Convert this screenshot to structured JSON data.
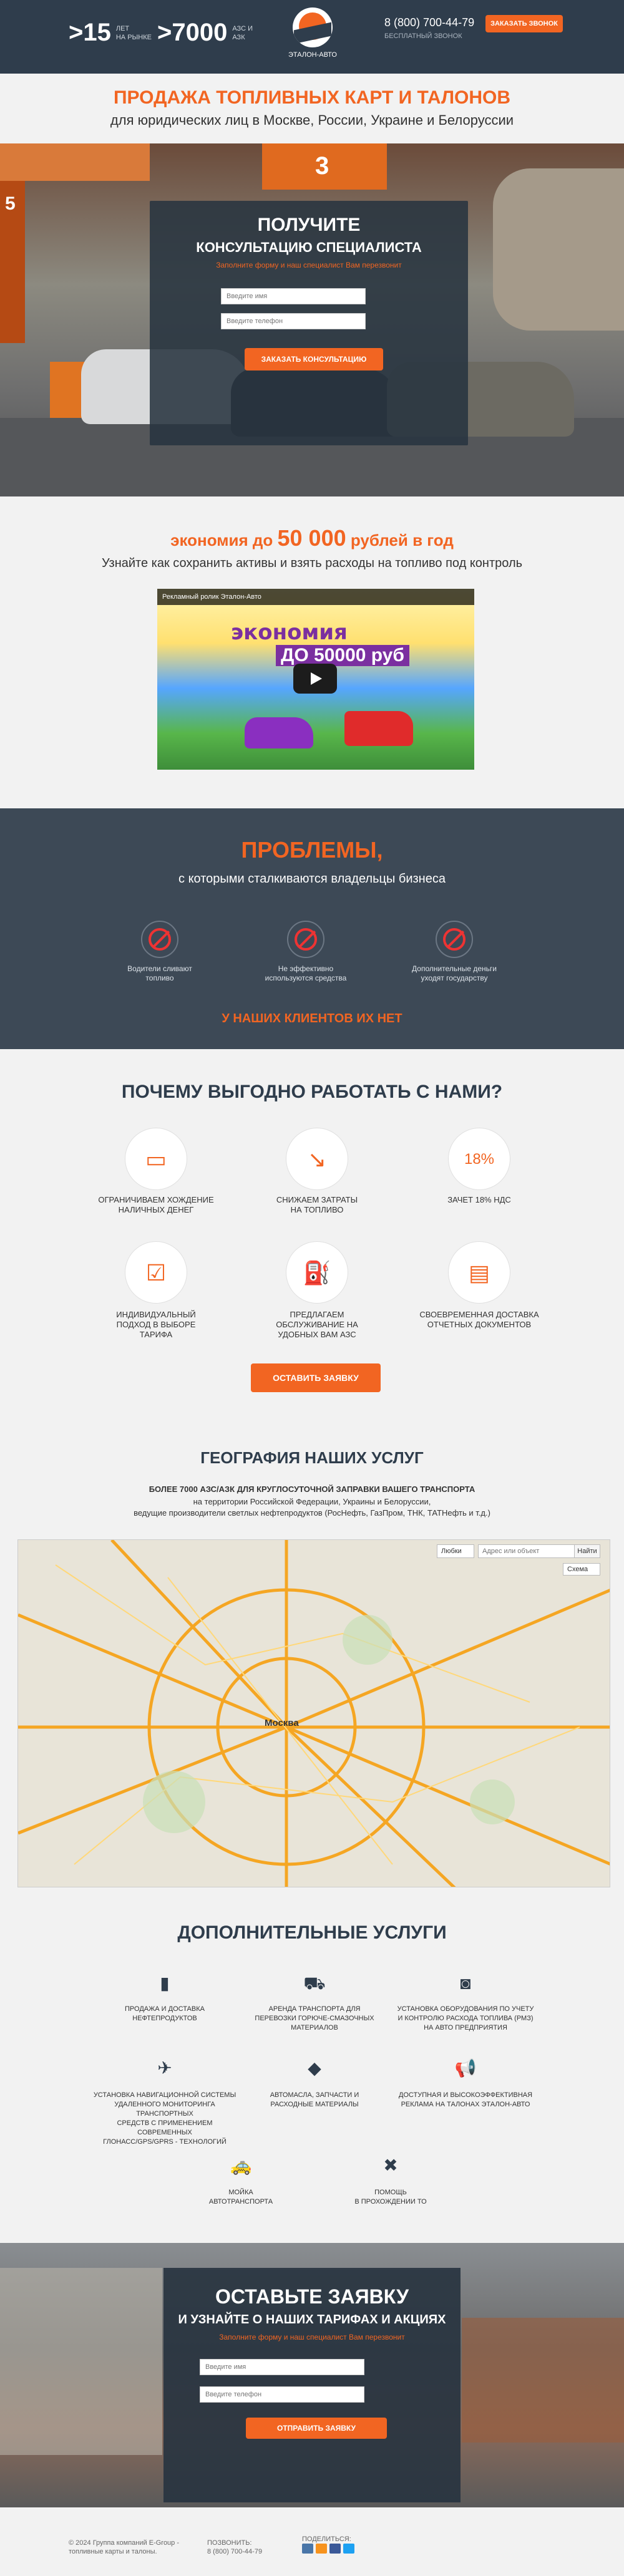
{
  "header": {
    "stat1_value": ">15",
    "stat1_label": "ЛЕТ\nНА РЫНКЕ",
    "stat2_value": ">7000",
    "stat2_label": "АЗС И\nАЗК",
    "logo_text": "ЭТАЛОН-АВТО",
    "phone": "8 (800) 700-44-79",
    "phone_sub": "БЕСПЛАТНЫЙ ЗВОНОК",
    "call_button": "ЗАКАЗАТЬ ЗВОНОК"
  },
  "hero": {
    "title": "ПРОДАЖА ТОПЛИВНЫХ КАРТ И ТАЛОНОВ",
    "subtitle": "для юридических лиц в Москве, России, Украине и Белоруссии",
    "pump_number_1": "3",
    "pump_number_2": "5",
    "form_title_1": "ПОЛУЧИТЕ",
    "form_title_2": "КОНСУЛЬТАЦИЮ СПЕЦИАЛИСТА",
    "form_hint": "Заполните форму и наш специалист Вам перезвонит",
    "name_placeholder": "Введите имя",
    "phone_placeholder": "Введите телефон",
    "submit": "ЗАКАЗАТЬ КОНСУЛЬТАЦИЮ"
  },
  "economy": {
    "prefix": "экономия до ",
    "number": "50 000",
    "suffix": " рублей в год",
    "subtitle": "Узнайте как сохранить активы и взять расходы на топливо под контроль",
    "video_title": "Рекламный ролик Эталон-Авто",
    "video_text_1": "экономия",
    "video_text_2": "ДО 50000 руб"
  },
  "problems": {
    "title": "ПРОБЛЕМЫ,",
    "subtitle": "с которыми сталкиваются владельцы бизнеса",
    "items": [
      {
        "label": "Водители сливают\nтопливо"
      },
      {
        "label": "Не эффективно\nиспользуются средства"
      },
      {
        "label": "Дополнительные деньги\nуходят государству"
      }
    ],
    "none_text": "У НАШИХ КЛИЕНТОВ ИХ НЕТ"
  },
  "why": {
    "title": "ПОЧЕМУ ВЫГОДНО РАБОТАТЬ С НАМИ?",
    "items": [
      {
        "icon": "card-icon",
        "glyph": "▭",
        "label": "ОГРАНИЧИВАЕМ ХОЖДЕНИЕ\nНАЛИЧНЫХ ДЕНЕГ"
      },
      {
        "icon": "chart-down-icon",
        "glyph": "↘",
        "label": "СНИЖАЕМ ЗАТРАТЫ\nНА ТОПЛИВО"
      },
      {
        "icon": "percent-icon",
        "glyph": "18%",
        "label": "ЗАЧЕТ 18% НДС"
      },
      {
        "icon": "checkbox-icon",
        "glyph": "☑",
        "label": "ИНДИВИДУАЛЬНЫЙ\nПОДХОД В ВЫБОРЕ\nТАРИФА"
      },
      {
        "icon": "fuel-nozzle-icon",
        "glyph": "⛽",
        "label": "ПРЕДЛАГАЕМ\nОБСЛУЖИВАНИЕ НА\nУДОБНЫХ ВАМ АЗС"
      },
      {
        "icon": "document-icon",
        "glyph": "▤",
        "label": "СВОЕВРЕМЕННАЯ ДОСТАВКА\nОТЧЕТНЫХ ДОКУМЕНТОВ"
      }
    ],
    "button": "ОСТАВИТЬ ЗАЯВКУ"
  },
  "geography": {
    "title": "ГЕОГРАФИЯ НАШИХ УСЛУГ",
    "line1": "БОЛЕЕ 7000 АЗС/АЗК ДЛЯ КРУГЛОСУТОЧНОЙ ЗАПРАВКИ ВАШЕГО ТРАНСПОРТА",
    "line2": "на территории Российской Федерации, Украины и Белоруссии,",
    "line3": "ведущие производители светлых нефтепродуктов (РосНефть, ГазПром, ТНК, ТАТНефть и т.д.)",
    "city": "Москва",
    "map_search_placeholder": "Адрес или объект",
    "map_find": "Найти",
    "map_type": "Схема",
    "map_favorites": "Любки"
  },
  "additional": {
    "title": "ДОПОЛНИТЕЛЬНЫЕ УСЛУГИ",
    "items": [
      {
        "icon": "fuel-can-icon",
        "glyph": "▮",
        "label": "ПРОДАЖА И ДОСТАВКА\nНЕФТЕПРОДУКТОВ"
      },
      {
        "icon": "truck-icon",
        "glyph": "⛟",
        "label": "АРЕНДА ТРАНСПОРТА ДЛЯ\nПЕРЕВОЗКИ ГОРЮЧЕ-СМАЗОЧНЫХ\nМАТЕРИАЛОВ"
      },
      {
        "icon": "device-icon",
        "glyph": "◙",
        "label": "УСТАНОВКА ОБОРУДОВАНИЯ ПО УЧЕТУ\nИ КОНТРОЛЮ РАСХОДА ТОПЛИВА (РМЗ)\nНА АВТО ПРЕДПРИЯТИЯ"
      },
      {
        "icon": "satellite-icon",
        "glyph": "✈",
        "label": "УСТАНОВКА НАВИГАЦИОННОЙ СИСТЕМЫ\nУДАЛЕННОГО МОНИТОРИНГА ТРАНСПОРТНЫХ\nСРЕДСТВ С ПРИМЕНЕНИЕМ СОВРЕМЕННЫХ\nГЛОНАСС/GPS/GPRS - ТЕХНОЛОГИЙ"
      },
      {
        "icon": "oil-can-icon",
        "glyph": "◆",
        "label": "АВТОМАСЛА, ЗАПЧАСТИ И\nРАСХОДНЫЕ МАТЕРИАЛЫ"
      },
      {
        "icon": "megaphone-icon",
        "glyph": "📢",
        "label": "ДОСТУПНАЯ И ВЫСОКОЭФФЕКТИВНАЯ\nРЕКЛАМА НА ТАЛОНАХ ЭТАЛОН-АВТО"
      },
      {
        "icon": "car-wash-icon",
        "glyph": "🚕",
        "label": "МОЙКА\nАВТОТРАНСПОРТА"
      },
      {
        "icon": "tools-icon",
        "glyph": "✖",
        "label": "ПОМОЩЬ\nВ ПРОХОЖДЕНИИ ТО"
      }
    ]
  },
  "bottom_form": {
    "title_1": "ОСТАВЬТЕ ЗАЯВКУ",
    "title_2": "И УЗНАЙТЕ О НАШИХ ТАРИФАХ И АКЦИЯХ",
    "hint": "Заполните форму и наш специалист Вам перезвонит",
    "name_placeholder": "Введите имя",
    "phone_placeholder": "Введите телефон",
    "submit": "ОТПРАВИТЬ ЗАЯВКУ"
  },
  "footer": {
    "copyright": "© 2024 Группа компаний Е-Group -\nтопливные карты и талоны.",
    "call_label": "ПОЗВОНИТЬ:",
    "phone": "8 (800) 700-44-79",
    "share_label": "ПОДЕЛИТЬСЯ:"
  },
  "colors": {
    "accent": "#f26522",
    "dark": "#2f3d4c",
    "problems_bg": "#3d4956"
  }
}
